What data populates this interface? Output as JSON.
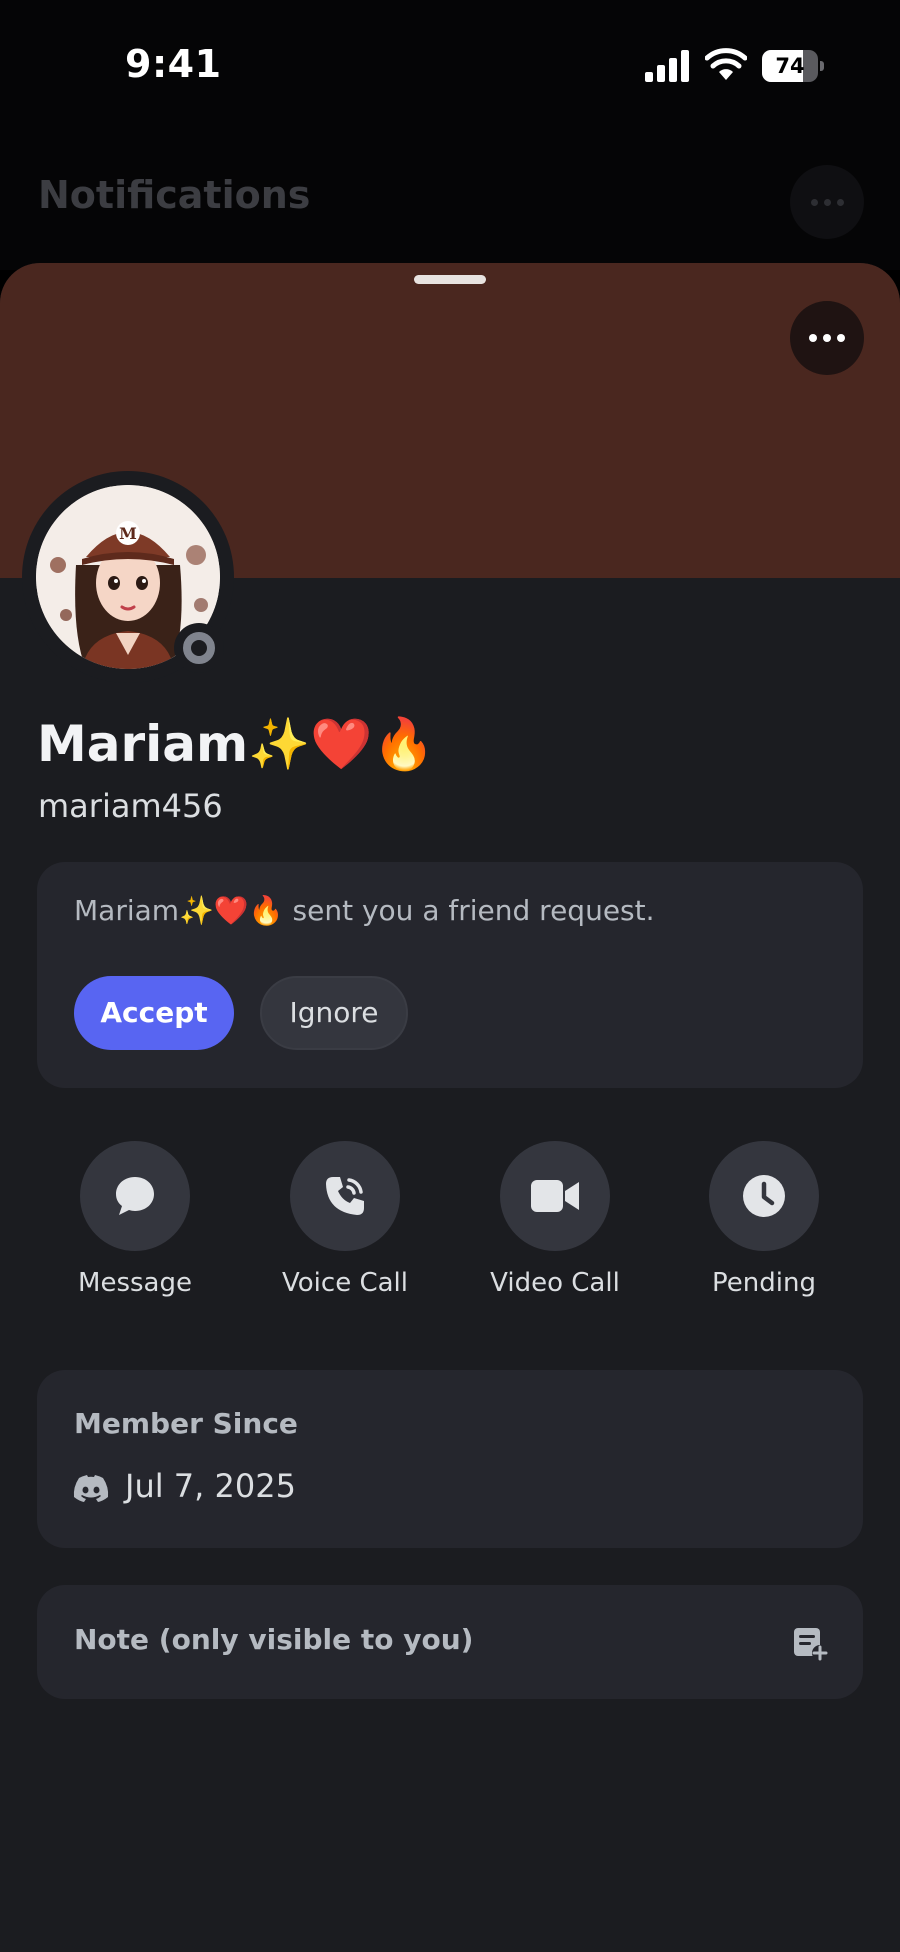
{
  "status_bar": {
    "time": "9:41",
    "battery_level": "74",
    "battery_fraction": 0.74,
    "icons": [
      "cellular-signal-icon",
      "wifi-icon",
      "battery-icon"
    ]
  },
  "background_page": {
    "title": "Notifications"
  },
  "profile": {
    "banner_color": "#4a271f",
    "display_name": "Mariam✨❤️🔥",
    "username": "mariam456",
    "status": "offline"
  },
  "friend_request": {
    "message": "Mariam✨❤️🔥 sent you a friend request.",
    "accept_label": "Accept",
    "ignore_label": "Ignore"
  },
  "actions": [
    {
      "label": "Message",
      "icon": "message-icon"
    },
    {
      "label": "Voice Call",
      "icon": "voice-call-icon"
    },
    {
      "label": "Video Call",
      "icon": "video-call-icon"
    },
    {
      "label": "Pending",
      "icon": "pending-clock-icon"
    }
  ],
  "member_since": {
    "title": "Member Since",
    "date": "Jul 7, 2025"
  },
  "note": {
    "placeholder": "Note (only visible to you)"
  },
  "colors": {
    "accent": "#5865f2",
    "card_bg": "#25262d",
    "sheet_bg": "#1b1c20"
  }
}
